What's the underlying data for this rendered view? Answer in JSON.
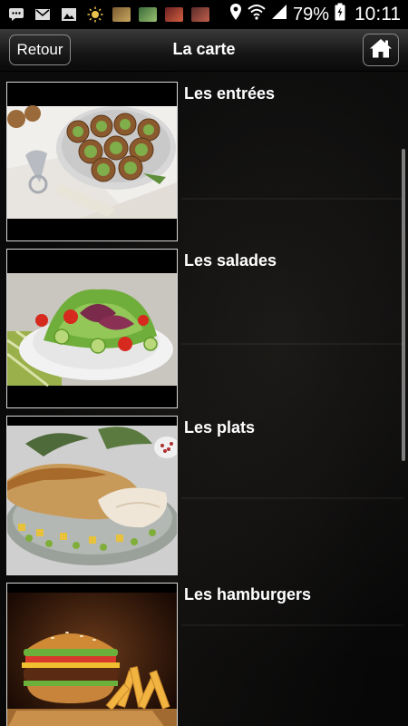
{
  "status_bar": {
    "battery": "79%",
    "time": "10:11"
  },
  "header": {
    "back_label": "Retour",
    "title": "La carte"
  },
  "menu_items": [
    {
      "label": "Les entrées"
    },
    {
      "label": "Les salades"
    },
    {
      "label": "Les plats"
    },
    {
      "label": "Les hamburgers"
    }
  ]
}
